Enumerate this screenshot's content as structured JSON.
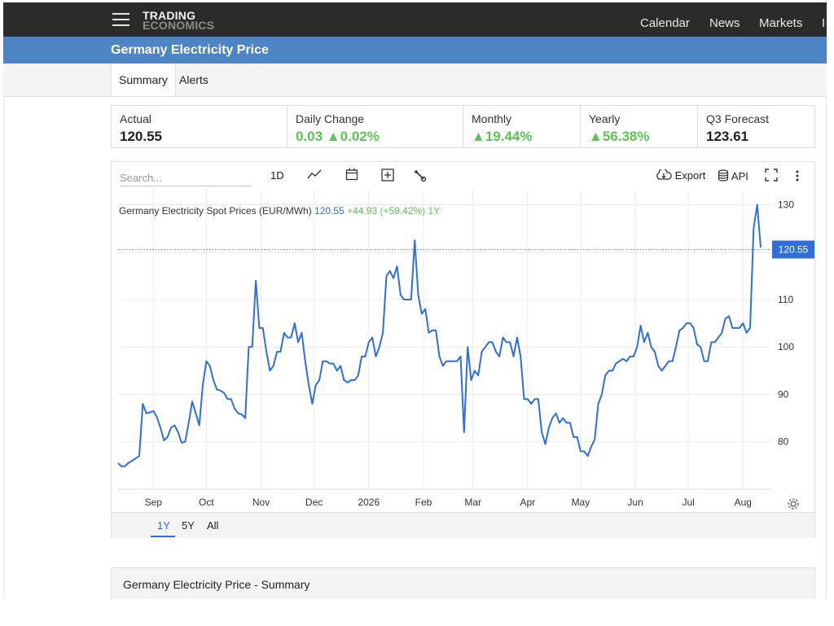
{
  "header": {
    "logo_line1": "TRADING",
    "logo_line2": "ECONOMICS",
    "nav": [
      "Calendar",
      "News",
      "Markets",
      "I"
    ]
  },
  "page_title": "Germany Electricity Price",
  "tabs": [
    "Summary",
    "Alerts"
  ],
  "stats": [
    {
      "label": "Actual",
      "value": "120.55"
    },
    {
      "label": "Daily Change",
      "value": "0.03 ▲0.02%"
    },
    {
      "label": "Monthly",
      "value": "▲19.44%"
    },
    {
      "label": "Yearly",
      "value": "▲56.38%"
    },
    {
      "label": "Q3 Forecast",
      "value": "123.61"
    }
  ],
  "toolbar": {
    "search_placeholder": "Search...",
    "interval_label": "1D",
    "export_label": "Export",
    "api_label": "API"
  },
  "ranges": [
    "1Y",
    "5Y",
    "All"
  ],
  "summary_title": "Germany Electricity Price - Summary",
  "colors": {
    "line": "#2f6fdb",
    "green": "#5cc552",
    "accent_bar": "#4d84c4"
  },
  "chart_data": {
    "type": "line",
    "legend": {
      "name": "Germany Electricity Spot Prices (EUR/MWh)",
      "last": "120.55",
      "change": "+44.93 (+59.42%)",
      "period": "1Y"
    },
    "last_value_label": "120.55",
    "x_tick_labels": [
      "Sep",
      "Oct",
      "Nov",
      "Dec",
      "2026",
      "Feb",
      "Mar",
      "Apr",
      "May",
      "Jun",
      "Jul",
      "Aug"
    ],
    "y_tick_labels": [
      "80",
      "90",
      "100",
      "110",
      "120",
      "130"
    ],
    "ylim": [
      70,
      133
    ],
    "y_label_values": [
      80,
      90,
      100,
      110,
      130
    ],
    "grid": true,
    "x": [
      "2025-08-12",
      "2025-08-14",
      "2025-08-16",
      "2025-08-18",
      "2025-08-20",
      "2025-08-22",
      "2025-08-24",
      "2025-08-26",
      "2025-08-28",
      "2025-08-30",
      "2025-09-01",
      "2025-09-03",
      "2025-09-05",
      "2025-09-07",
      "2025-09-09",
      "2025-09-11",
      "2025-09-13",
      "2025-09-15",
      "2025-09-17",
      "2025-09-19",
      "2025-09-21",
      "2025-09-23",
      "2025-09-25",
      "2025-09-27",
      "2025-09-29",
      "2025-10-01",
      "2025-10-03",
      "2025-10-05",
      "2025-10-07",
      "2025-10-09",
      "2025-10-11",
      "2025-10-13",
      "2025-10-15",
      "2025-10-17",
      "2025-10-19",
      "2025-10-21",
      "2025-10-23",
      "2025-10-25",
      "2025-10-27",
      "2025-10-29",
      "2025-10-31",
      "2025-11-02",
      "2025-11-04",
      "2025-11-06",
      "2025-11-08",
      "2025-11-10",
      "2025-11-12",
      "2025-11-14",
      "2025-11-16",
      "2025-11-18",
      "2025-11-20",
      "2025-11-22",
      "2025-11-24",
      "2025-11-26",
      "2025-11-28",
      "2025-11-30",
      "2025-12-02",
      "2025-12-04",
      "2025-12-06",
      "2025-12-08",
      "2025-12-10",
      "2025-12-12",
      "2025-12-14",
      "2025-12-16",
      "2025-12-18",
      "2025-12-20",
      "2025-12-22",
      "2025-12-24",
      "2025-12-26",
      "2025-12-28",
      "2025-12-30",
      "2026-01-01",
      "2026-01-03",
      "2026-01-05",
      "2026-01-07",
      "2026-01-09",
      "2026-01-11",
      "2026-01-13",
      "2026-01-15",
      "2026-01-17",
      "2026-01-19",
      "2026-01-21",
      "2026-01-23",
      "2026-01-25",
      "2026-01-27",
      "2026-01-29",
      "2026-01-31",
      "2026-02-02",
      "2026-02-04",
      "2026-02-06",
      "2026-02-08",
      "2026-02-10",
      "2026-02-12",
      "2026-02-14",
      "2026-02-16",
      "2026-02-18",
      "2026-02-20",
      "2026-02-22",
      "2026-02-24",
      "2026-02-26",
      "2026-02-28",
      "2026-03-02",
      "2026-03-04",
      "2026-03-06",
      "2026-03-08",
      "2026-03-10",
      "2026-03-12",
      "2026-03-14",
      "2026-03-16",
      "2026-03-18",
      "2026-03-20",
      "2026-03-22",
      "2026-03-24",
      "2026-03-26",
      "2026-03-28",
      "2026-03-30",
      "2026-04-01",
      "2026-04-03",
      "2026-04-05",
      "2026-04-07",
      "2026-04-09",
      "2026-04-11",
      "2026-04-13",
      "2026-04-15",
      "2026-04-17",
      "2026-04-19",
      "2026-04-21",
      "2026-04-23",
      "2026-04-25",
      "2026-04-27",
      "2026-04-29",
      "2026-05-01",
      "2026-05-03",
      "2026-05-05",
      "2026-05-07",
      "2026-05-09",
      "2026-05-11",
      "2026-05-13",
      "2026-05-15",
      "2026-05-17",
      "2026-05-19",
      "2026-05-21",
      "2026-05-23",
      "2026-05-25",
      "2026-05-27",
      "2026-05-29",
      "2026-05-31",
      "2026-06-02",
      "2026-06-04",
      "2026-06-06",
      "2026-06-08",
      "2026-06-10",
      "2026-06-12",
      "2026-06-14",
      "2026-06-16",
      "2026-06-18",
      "2026-06-20",
      "2026-06-22",
      "2026-06-24",
      "2026-06-26",
      "2026-06-28",
      "2026-06-30",
      "2026-07-02",
      "2026-07-04",
      "2026-07-06",
      "2026-07-08",
      "2026-07-10",
      "2026-07-12",
      "2026-07-14",
      "2026-07-16",
      "2026-07-18",
      "2026-07-20",
      "2026-07-22",
      "2026-07-24",
      "2026-07-26",
      "2026-07-28",
      "2026-07-30",
      "2026-08-01",
      "2026-08-03",
      "2026-08-05",
      "2026-08-07",
      "2026-08-09",
      "2026-08-11"
    ],
    "values": [
      75.5,
      74.8,
      74.9,
      75.6,
      76,
      76.5,
      77,
      88,
      86,
      86.2,
      86.5,
      85.2,
      83,
      80.3,
      81,
      83,
      83.5,
      82,
      79.8,
      80,
      84,
      88.5,
      86,
      83.5,
      92,
      97,
      96,
      93,
      91,
      90.8,
      90.3,
      89,
      89,
      87,
      86,
      85.8,
      85,
      100,
      100,
      114,
      104,
      104,
      99,
      95,
      96,
      99,
      99,
      103,
      102,
      102,
      105,
      101,
      103,
      97,
      92,
      88,
      92,
      93,
      97,
      97,
      96.5,
      96.5,
      95,
      96,
      93,
      92.5,
      93,
      93,
      94,
      98,
      98,
      101,
      102,
      98,
      100,
      103,
      115,
      116,
      114.5,
      117,
      111,
      110,
      110,
      110,
      122.5,
      111,
      107,
      108,
      103,
      103.5,
      103.5,
      98,
      96,
      97,
      97,
      97,
      97,
      98,
      82,
      100,
      93,
      95,
      94,
      99,
      100,
      101,
      101,
      99,
      98,
      102,
      101,
      101,
      98,
      102,
      98,
      89,
      89,
      88,
      89,
      89,
      82,
      79.5,
      83,
      85,
      86,
      84,
      85,
      84,
      84,
      81,
      81,
      78,
      78,
      77,
      79,
      80.5,
      88,
      90,
      94,
      95,
      95,
      96.5,
      97,
      97.5,
      97,
      98,
      98,
      100,
      104.5,
      101,
      103,
      100,
      99,
      96,
      95,
      96,
      97,
      97,
      100,
      103.5,
      104,
      105,
      105,
      104,
      100.5,
      100,
      97,
      97,
      101,
      101,
      102,
      103,
      106,
      106.5,
      104,
      104,
      104,
      105,
      103,
      104,
      125,
      130,
      121,
      120,
      122,
      120.55,
      120.55
    ]
  }
}
